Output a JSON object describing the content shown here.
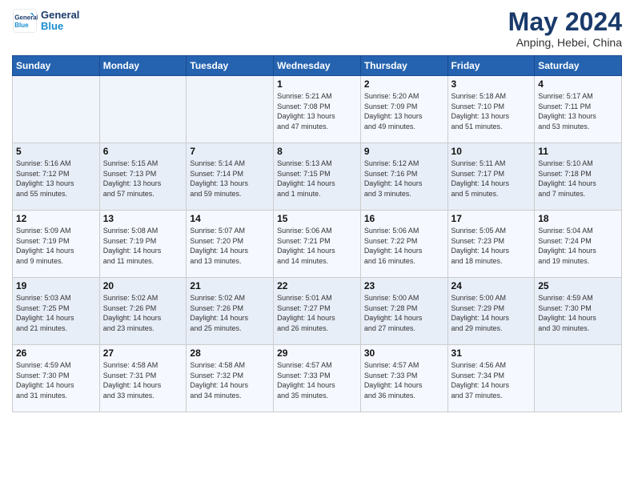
{
  "header": {
    "logo_line1": "General",
    "logo_line2": "Blue",
    "month_title": "May 2024",
    "location": "Anping, Hebei, China"
  },
  "days_of_week": [
    "Sunday",
    "Monday",
    "Tuesday",
    "Wednesday",
    "Thursday",
    "Friday",
    "Saturday"
  ],
  "weeks": [
    [
      {
        "day": "",
        "info": ""
      },
      {
        "day": "",
        "info": ""
      },
      {
        "day": "",
        "info": ""
      },
      {
        "day": "1",
        "info": "Sunrise: 5:21 AM\nSunset: 7:08 PM\nDaylight: 13 hours\nand 47 minutes."
      },
      {
        "day": "2",
        "info": "Sunrise: 5:20 AM\nSunset: 7:09 PM\nDaylight: 13 hours\nand 49 minutes."
      },
      {
        "day": "3",
        "info": "Sunrise: 5:18 AM\nSunset: 7:10 PM\nDaylight: 13 hours\nand 51 minutes."
      },
      {
        "day": "4",
        "info": "Sunrise: 5:17 AM\nSunset: 7:11 PM\nDaylight: 13 hours\nand 53 minutes."
      }
    ],
    [
      {
        "day": "5",
        "info": "Sunrise: 5:16 AM\nSunset: 7:12 PM\nDaylight: 13 hours\nand 55 minutes."
      },
      {
        "day": "6",
        "info": "Sunrise: 5:15 AM\nSunset: 7:13 PM\nDaylight: 13 hours\nand 57 minutes."
      },
      {
        "day": "7",
        "info": "Sunrise: 5:14 AM\nSunset: 7:14 PM\nDaylight: 13 hours\nand 59 minutes."
      },
      {
        "day": "8",
        "info": "Sunrise: 5:13 AM\nSunset: 7:15 PM\nDaylight: 14 hours\nand 1 minute."
      },
      {
        "day": "9",
        "info": "Sunrise: 5:12 AM\nSunset: 7:16 PM\nDaylight: 14 hours\nand 3 minutes."
      },
      {
        "day": "10",
        "info": "Sunrise: 5:11 AM\nSunset: 7:17 PM\nDaylight: 14 hours\nand 5 minutes."
      },
      {
        "day": "11",
        "info": "Sunrise: 5:10 AM\nSunset: 7:18 PM\nDaylight: 14 hours\nand 7 minutes."
      }
    ],
    [
      {
        "day": "12",
        "info": "Sunrise: 5:09 AM\nSunset: 7:19 PM\nDaylight: 14 hours\nand 9 minutes."
      },
      {
        "day": "13",
        "info": "Sunrise: 5:08 AM\nSunset: 7:19 PM\nDaylight: 14 hours\nand 11 minutes."
      },
      {
        "day": "14",
        "info": "Sunrise: 5:07 AM\nSunset: 7:20 PM\nDaylight: 14 hours\nand 13 minutes."
      },
      {
        "day": "15",
        "info": "Sunrise: 5:06 AM\nSunset: 7:21 PM\nDaylight: 14 hours\nand 14 minutes."
      },
      {
        "day": "16",
        "info": "Sunrise: 5:06 AM\nSunset: 7:22 PM\nDaylight: 14 hours\nand 16 minutes."
      },
      {
        "day": "17",
        "info": "Sunrise: 5:05 AM\nSunset: 7:23 PM\nDaylight: 14 hours\nand 18 minutes."
      },
      {
        "day": "18",
        "info": "Sunrise: 5:04 AM\nSunset: 7:24 PM\nDaylight: 14 hours\nand 19 minutes."
      }
    ],
    [
      {
        "day": "19",
        "info": "Sunrise: 5:03 AM\nSunset: 7:25 PM\nDaylight: 14 hours\nand 21 minutes."
      },
      {
        "day": "20",
        "info": "Sunrise: 5:02 AM\nSunset: 7:26 PM\nDaylight: 14 hours\nand 23 minutes."
      },
      {
        "day": "21",
        "info": "Sunrise: 5:02 AM\nSunset: 7:26 PM\nDaylight: 14 hours\nand 25 minutes."
      },
      {
        "day": "22",
        "info": "Sunrise: 5:01 AM\nSunset: 7:27 PM\nDaylight: 14 hours\nand 26 minutes."
      },
      {
        "day": "23",
        "info": "Sunrise: 5:00 AM\nSunset: 7:28 PM\nDaylight: 14 hours\nand 27 minutes."
      },
      {
        "day": "24",
        "info": "Sunrise: 5:00 AM\nSunset: 7:29 PM\nDaylight: 14 hours\nand 29 minutes."
      },
      {
        "day": "25",
        "info": "Sunrise: 4:59 AM\nSunset: 7:30 PM\nDaylight: 14 hours\nand 30 minutes."
      }
    ],
    [
      {
        "day": "26",
        "info": "Sunrise: 4:59 AM\nSunset: 7:30 PM\nDaylight: 14 hours\nand 31 minutes."
      },
      {
        "day": "27",
        "info": "Sunrise: 4:58 AM\nSunset: 7:31 PM\nDaylight: 14 hours\nand 33 minutes."
      },
      {
        "day": "28",
        "info": "Sunrise: 4:58 AM\nSunset: 7:32 PM\nDaylight: 14 hours\nand 34 minutes."
      },
      {
        "day": "29",
        "info": "Sunrise: 4:57 AM\nSunset: 7:33 PM\nDaylight: 14 hours\nand 35 minutes."
      },
      {
        "day": "30",
        "info": "Sunrise: 4:57 AM\nSunset: 7:33 PM\nDaylight: 14 hours\nand 36 minutes."
      },
      {
        "day": "31",
        "info": "Sunrise: 4:56 AM\nSunset: 7:34 PM\nDaylight: 14 hours\nand 37 minutes."
      },
      {
        "day": "",
        "info": ""
      }
    ]
  ]
}
